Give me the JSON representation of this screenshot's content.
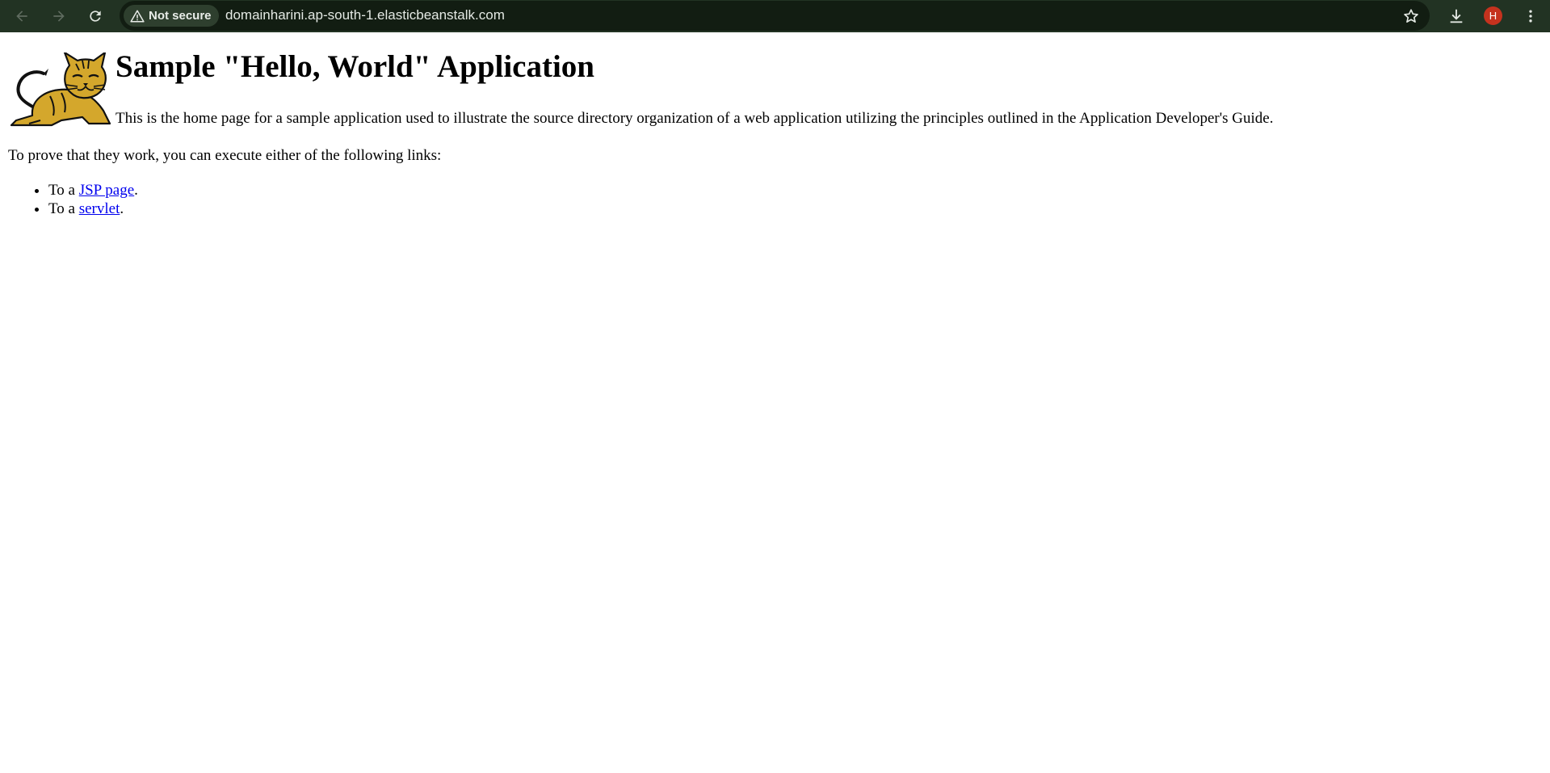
{
  "browser": {
    "security_label": "Not secure",
    "url": "domainharini.ap-south-1.elasticbeanstalk.com",
    "profile_initial": "H",
    "icons": {
      "back": "arrow-left-icon",
      "forward": "arrow-right-icon",
      "reload": "reload-icon",
      "security": "warning-triangle-icon",
      "bookmark": "star-outline-icon",
      "downloads": "download-icon",
      "menu": "kebab-menu-icon"
    },
    "colors": {
      "toolbar": "#223323",
      "omnibox": "#121d12",
      "avatar": "#c5321e"
    }
  },
  "page": {
    "title": "Sample \"Hello, World\" Application",
    "intro": "This is the home page for a sample application used to illustrate the source directory organization of a web application utilizing the principles outlined in the Application Developer's Guide.",
    "prove_text": "To prove that they work, you can execute either of the following links:",
    "links": [
      {
        "prefix": "To a ",
        "link_text": "JSP page",
        "suffix": "."
      },
      {
        "prefix": "To a ",
        "link_text": "servlet",
        "suffix": "."
      }
    ],
    "link_color": "#0000ee",
    "logo": "tomcat-cat-logo"
  }
}
